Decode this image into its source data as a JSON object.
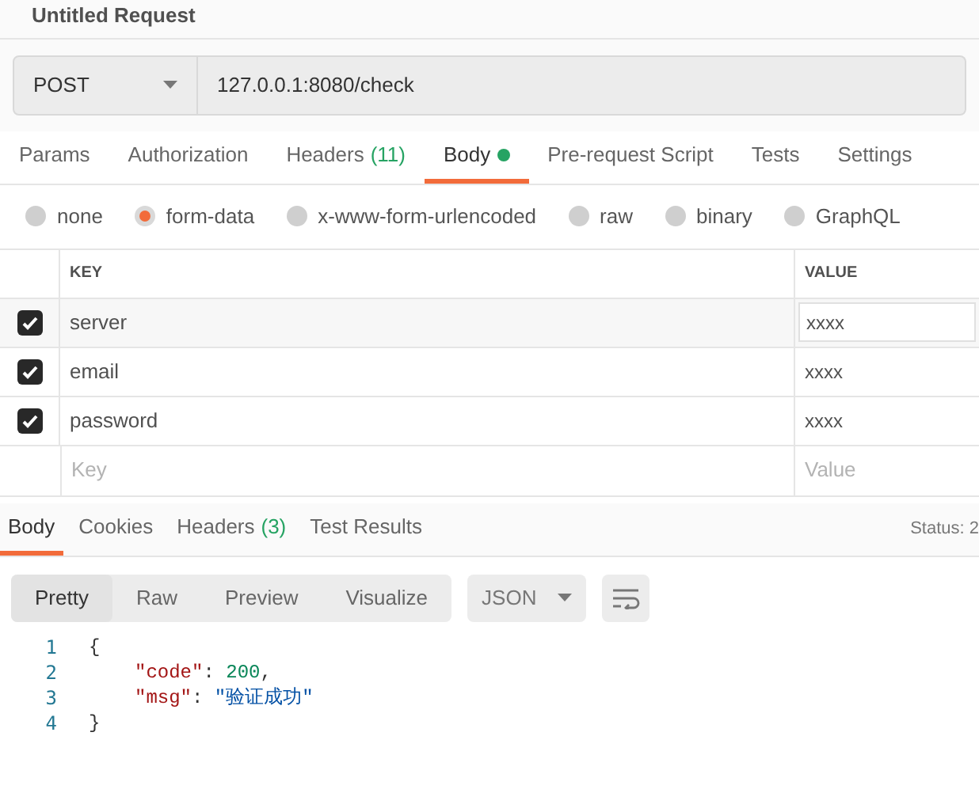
{
  "request": {
    "title": "Untitled Request",
    "method": "POST",
    "url": "127.0.0.1:8080/check"
  },
  "request_tabs": [
    {
      "label": "Params",
      "has_content": false,
      "selected": false
    },
    {
      "label": "Authorization",
      "has_content": false,
      "selected": false
    },
    {
      "label": "Headers",
      "count": "(11)",
      "has_content": false,
      "selected": false
    },
    {
      "label": "Body",
      "has_content": true,
      "selected": true
    },
    {
      "label": "Pre-request Script",
      "has_content": false,
      "selected": false
    },
    {
      "label": "Tests",
      "has_content": false,
      "selected": false
    },
    {
      "label": "Settings",
      "has_content": false,
      "selected": false
    }
  ],
  "body_types": [
    {
      "label": "none",
      "selected": false
    },
    {
      "label": "form-data",
      "selected": true
    },
    {
      "label": "x-www-form-urlencoded",
      "selected": false
    },
    {
      "label": "raw",
      "selected": false
    },
    {
      "label": "binary",
      "selected": false
    },
    {
      "label": "GraphQL",
      "selected": false
    }
  ],
  "params_table": {
    "columns": [
      "KEY",
      "VALUE"
    ],
    "rows": [
      {
        "key": "server",
        "value": "xxxx",
        "checked": true,
        "selected": true
      },
      {
        "key": "email",
        "value": "xxxx",
        "checked": true,
        "selected": false
      },
      {
        "key": "password",
        "value": "xxxx",
        "checked": true,
        "selected": false
      }
    ],
    "new_row": {
      "key_placeholder": "Key",
      "value_placeholder": "Value"
    }
  },
  "response_tabs": [
    {
      "label": "Body",
      "selected": true
    },
    {
      "label": "Cookies",
      "selected": false
    },
    {
      "label": "Headers",
      "count": "(3)",
      "selected": false
    },
    {
      "label": "Test Results",
      "selected": false
    }
  ],
  "status": "Status: 2",
  "view_modes": [
    {
      "label": "Pretty",
      "selected": true
    },
    {
      "label": "Raw",
      "selected": false
    },
    {
      "label": "Preview",
      "selected": false
    },
    {
      "label": "Visualize",
      "selected": false
    }
  ],
  "format": "JSON",
  "code_lines": [
    {
      "number": "1",
      "kind": "brace",
      "tokens": [
        {
          "kind": "punct",
          "text": "{"
        }
      ]
    },
    {
      "number": "2",
      "kind": "member",
      "tokens": [
        {
          "kind": "key",
          "text": "\"code\""
        },
        {
          "kind": "punct",
          "text": ": "
        },
        {
          "kind": "number",
          "text": "200"
        },
        {
          "kind": "punct",
          "text": ","
        }
      ]
    },
    {
      "number": "3",
      "kind": "member",
      "tokens": [
        {
          "kind": "key",
          "text": "\"msg\""
        },
        {
          "kind": "punct",
          "text": ": "
        },
        {
          "kind": "string",
          "text": "\"验证成功\""
        }
      ]
    },
    {
      "number": "4",
      "kind": "brace",
      "tokens": [
        {
          "kind": "punct",
          "text": "}"
        }
      ]
    }
  ]
}
